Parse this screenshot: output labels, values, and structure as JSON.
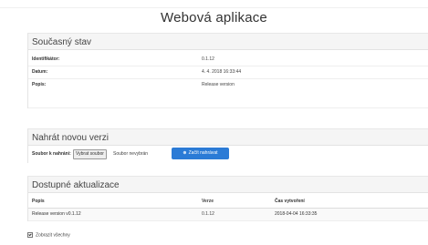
{
  "app": {
    "title": "Webová aplikace"
  },
  "current_state": {
    "heading": "Současný stav",
    "rows": [
      {
        "label": "Identifikátor:",
        "value": "0.1.12"
      },
      {
        "label": "Datum:",
        "value": "4. 4. 2018 16:33:44"
      },
      {
        "label": "Popis:",
        "value": "Release version"
      }
    ]
  },
  "upload": {
    "heading": "Nahrát novou verzi",
    "file_label": "Soubor k nahrání:",
    "choose_button": "Vybrat soubor",
    "no_file": "Soubor nevybrán",
    "start_button": "Začít nahrávat",
    "start_icon": "plus-circle-icon"
  },
  "updates": {
    "heading": "Dostupné aktualizace",
    "columns": [
      "Popis",
      "Verze",
      "Čas vytvoření"
    ],
    "rows": [
      {
        "description": "Release version v0.1.12",
        "version": "0.1.12",
        "created": "2018-04-04 16:33:35"
      }
    ],
    "show_all_label": "Zobrazit všechny",
    "show_all_checked": true
  },
  "colors": {
    "primary": "#2b7bd6",
    "panel_heading_bg": "#f5f5f5"
  }
}
